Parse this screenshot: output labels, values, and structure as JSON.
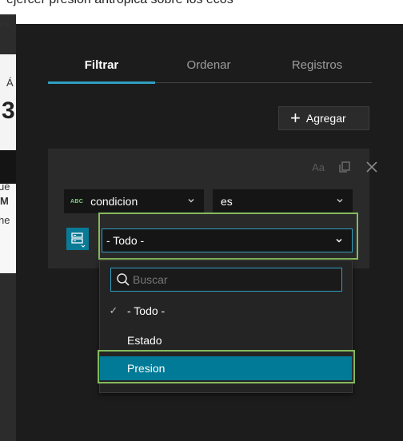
{
  "caption": "ejercer presión antrópica sobre los ecos",
  "background_fragments": [
    "es",
    "Á",
    "3",
    "ue",
    "M",
    "he"
  ],
  "tabs": [
    {
      "label": "Filtrar",
      "active": true
    },
    {
      "label": "Ordenar",
      "active": false
    },
    {
      "label": "Registros",
      "active": false
    }
  ],
  "add_button": {
    "label": "Agregar",
    "icon": "plus-icon"
  },
  "card_icons": {
    "case": "Aa",
    "duplicate": "copy-icon",
    "remove": "close-icon"
  },
  "field_select": {
    "type_badge": "ABC",
    "value": "condicion"
  },
  "operator_select": {
    "value": "es"
  },
  "value_select": {
    "value": "- Todo -"
  },
  "dropdown": {
    "search_placeholder": "Buscar",
    "options": [
      {
        "label": "- Todo -",
        "checked": true
      },
      {
        "label": "Estado",
        "checked": false
      },
      {
        "label": "Presion",
        "checked": false,
        "highlighted": true
      }
    ]
  },
  "colors": {
    "accent": "#2f9fc0",
    "highlight_outline": "#86b95c",
    "selected_row": "#007a96",
    "panel": "#1c1c1c"
  }
}
